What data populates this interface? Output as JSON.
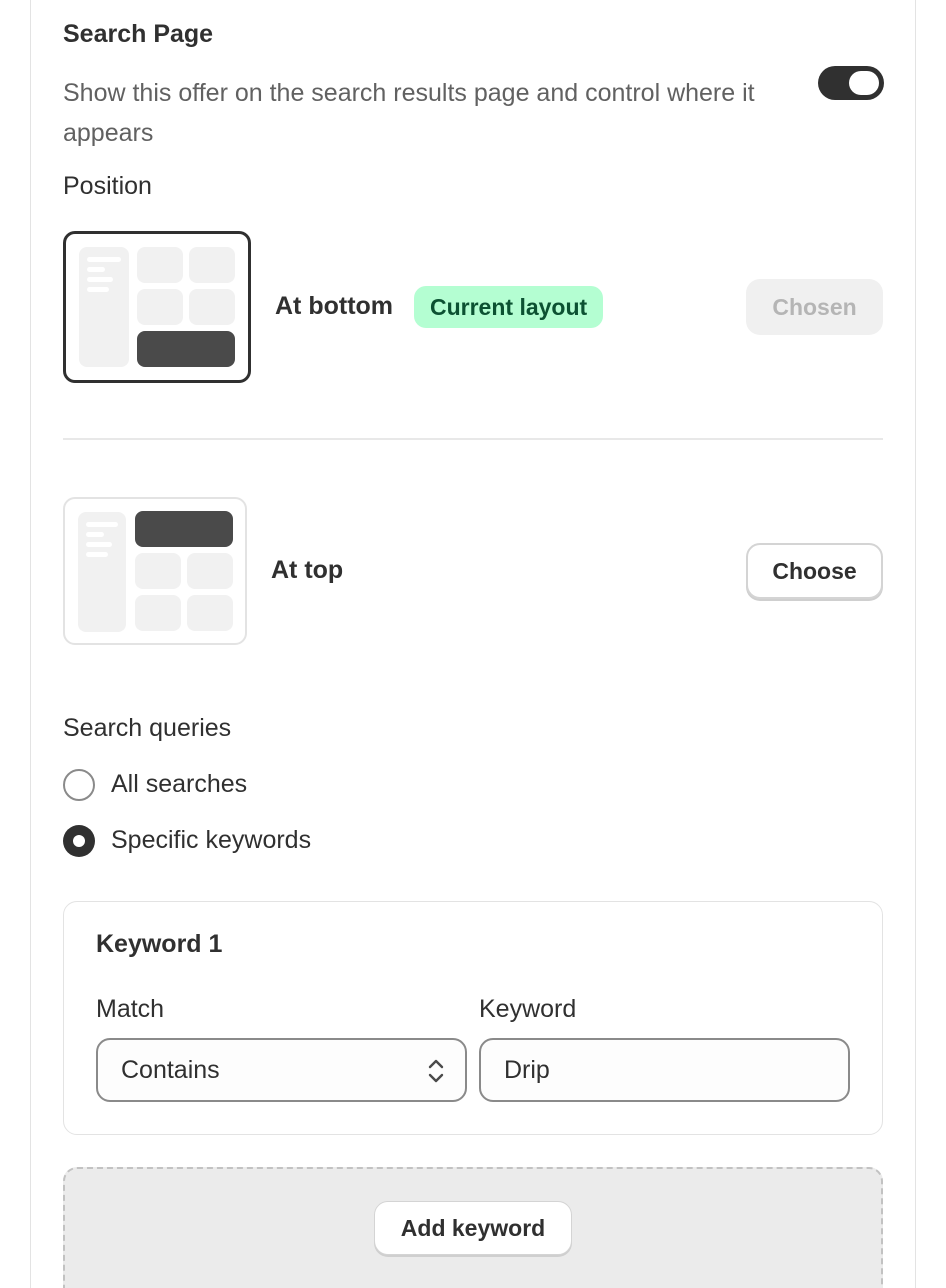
{
  "section": {
    "title": "Search Page",
    "description": "Show this offer on the search results page and control where it appears",
    "toggle_on": true
  },
  "position": {
    "label": "Position",
    "options": [
      {
        "name": "At bottom",
        "badge": "Current layout",
        "button": "Chosen",
        "selected": true
      },
      {
        "name": "At top",
        "button": "Choose",
        "selected": false
      }
    ]
  },
  "search_queries": {
    "label": "Search queries",
    "options": [
      {
        "label": "All searches",
        "checked": false
      },
      {
        "label": "Specific keywords",
        "checked": true
      }
    ]
  },
  "keyword_card": {
    "title": "Keyword 1",
    "match_label": "Match",
    "match_value": "Contains",
    "keyword_label": "Keyword",
    "keyword_value": "Drip"
  },
  "add_keyword_label": "Add keyword",
  "colors": {
    "badge_bg": "#b4fed2",
    "badge_text": "#0c5132",
    "primary_dark": "#303030"
  }
}
